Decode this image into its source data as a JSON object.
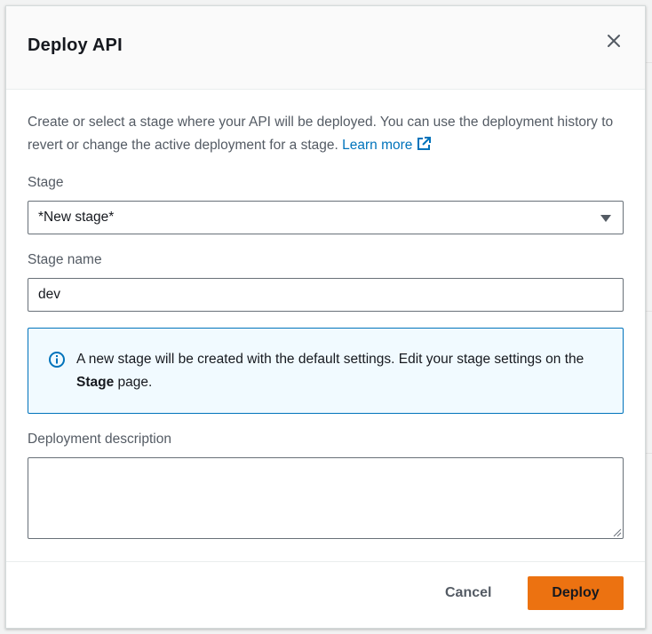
{
  "modal": {
    "title": "Deploy API",
    "intro_text": "Create or select a stage where your API will be deployed. You can use the deployment history to revert or change the active deployment for a stage.",
    "learn_more": "Learn more"
  },
  "stage_field": {
    "label": "Stage",
    "selected": "*New stage*"
  },
  "stage_name_field": {
    "label": "Stage name",
    "value": "dev"
  },
  "info_alert": {
    "text_before": "A new stage will be created with the default settings. Edit your stage settings on the ",
    "bold": "Stage",
    "text_after": " page."
  },
  "description_field": {
    "label": "Deployment description",
    "value": ""
  },
  "footer": {
    "cancel_label": "Cancel",
    "deploy_label": "Deploy"
  },
  "colors": {
    "primary": "#ec7211",
    "link": "#0073bb",
    "alert_bg": "#f1faff"
  },
  "icons": {
    "close": "close-icon",
    "external_link": "external-link-icon",
    "caret": "caret-down-icon",
    "info": "info-icon"
  }
}
